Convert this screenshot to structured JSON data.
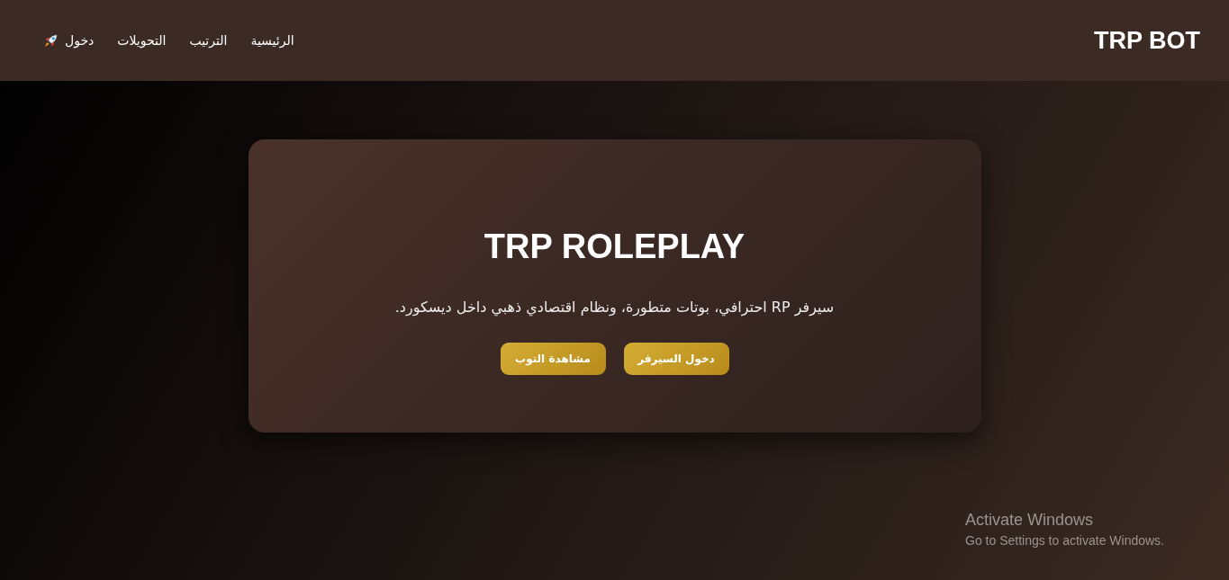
{
  "header": {
    "logo": "TRP BOT",
    "nav": [
      {
        "label": "الرئيسية",
        "kind": "page"
      },
      {
        "label": "الترتيب",
        "kind": "page"
      },
      {
        "label": "التحويلات",
        "kind": "page"
      },
      {
        "label": "دخول",
        "kind": "login"
      }
    ]
  },
  "hero": {
    "title": "TRP ROLEPLAY",
    "description": "سيرفر RP احترافي، بوتات متطورة، ونظام اقتصادي ذهبي داخل ديسكورد.",
    "buttons": [
      "دخول السيرفر",
      "مشاهدة التوب"
    ]
  },
  "os_notice": {
    "title": "Activate Windows",
    "text": "Go to Settings to activate Windows."
  }
}
